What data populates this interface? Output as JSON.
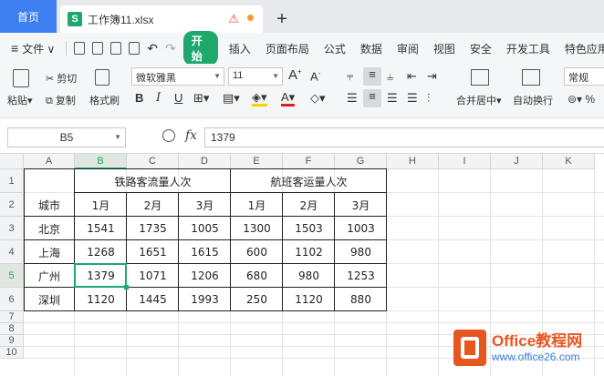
{
  "tabs": {
    "home": "首页",
    "file": "工作簿11.xlsx",
    "file_icon": "S",
    "new": "+"
  },
  "menu": {
    "file": "文件",
    "start": "开始",
    "items": [
      "插入",
      "页面布局",
      "公式",
      "数据",
      "审阅",
      "视图",
      "安全",
      "开发工具",
      "特色应用"
    ]
  },
  "ribbon": {
    "paste": "粘贴",
    "cut": "剪切",
    "copy": "复制",
    "format_painter": "格式刷",
    "font_name": "微软雅黑",
    "font_size": "11",
    "merge_center": "合并居中",
    "wrap_text": "自动换行",
    "number_style": "常规"
  },
  "formula_bar": {
    "name_box": "B5",
    "fx": "fx",
    "value": "1379"
  },
  "sheet": {
    "columns": [
      "A",
      "B",
      "C",
      "D",
      "E",
      "F",
      "G",
      "H",
      "I",
      "J",
      "K"
    ],
    "rows": [
      "1",
      "2",
      "3",
      "4",
      "5",
      "6",
      "7",
      "8",
      "9",
      "10"
    ],
    "selected_column": "B",
    "selected_row": "5",
    "header_rail": "铁路客流量人次",
    "header_air": "航班客运量人次",
    "city_label": "城市",
    "months": [
      "1月",
      "2月",
      "3月",
      "1月",
      "2月",
      "3月"
    ],
    "data_rows": [
      {
        "city": "北京",
        "values": [
          "1541",
          "1735",
          "1005",
          "1300",
          "1503",
          "1003"
        ]
      },
      {
        "city": "上海",
        "values": [
          "1268",
          "1651",
          "1615",
          "600",
          "1102",
          "980"
        ]
      },
      {
        "city": "广州",
        "values": [
          "1379",
          "1071",
          "1206",
          "680",
          "980",
          "1253"
        ]
      },
      {
        "city": "深圳",
        "values": [
          "1120",
          "1445",
          "1993",
          "250",
          "1120",
          "880"
        ]
      }
    ]
  },
  "watermark": {
    "brand": "Office教程网",
    "url": "www.office26.com"
  },
  "colors": {
    "accent_green": "#1fa86b",
    "tab_blue": "#3d7ff0",
    "watermark_orange": "#e8561f"
  }
}
